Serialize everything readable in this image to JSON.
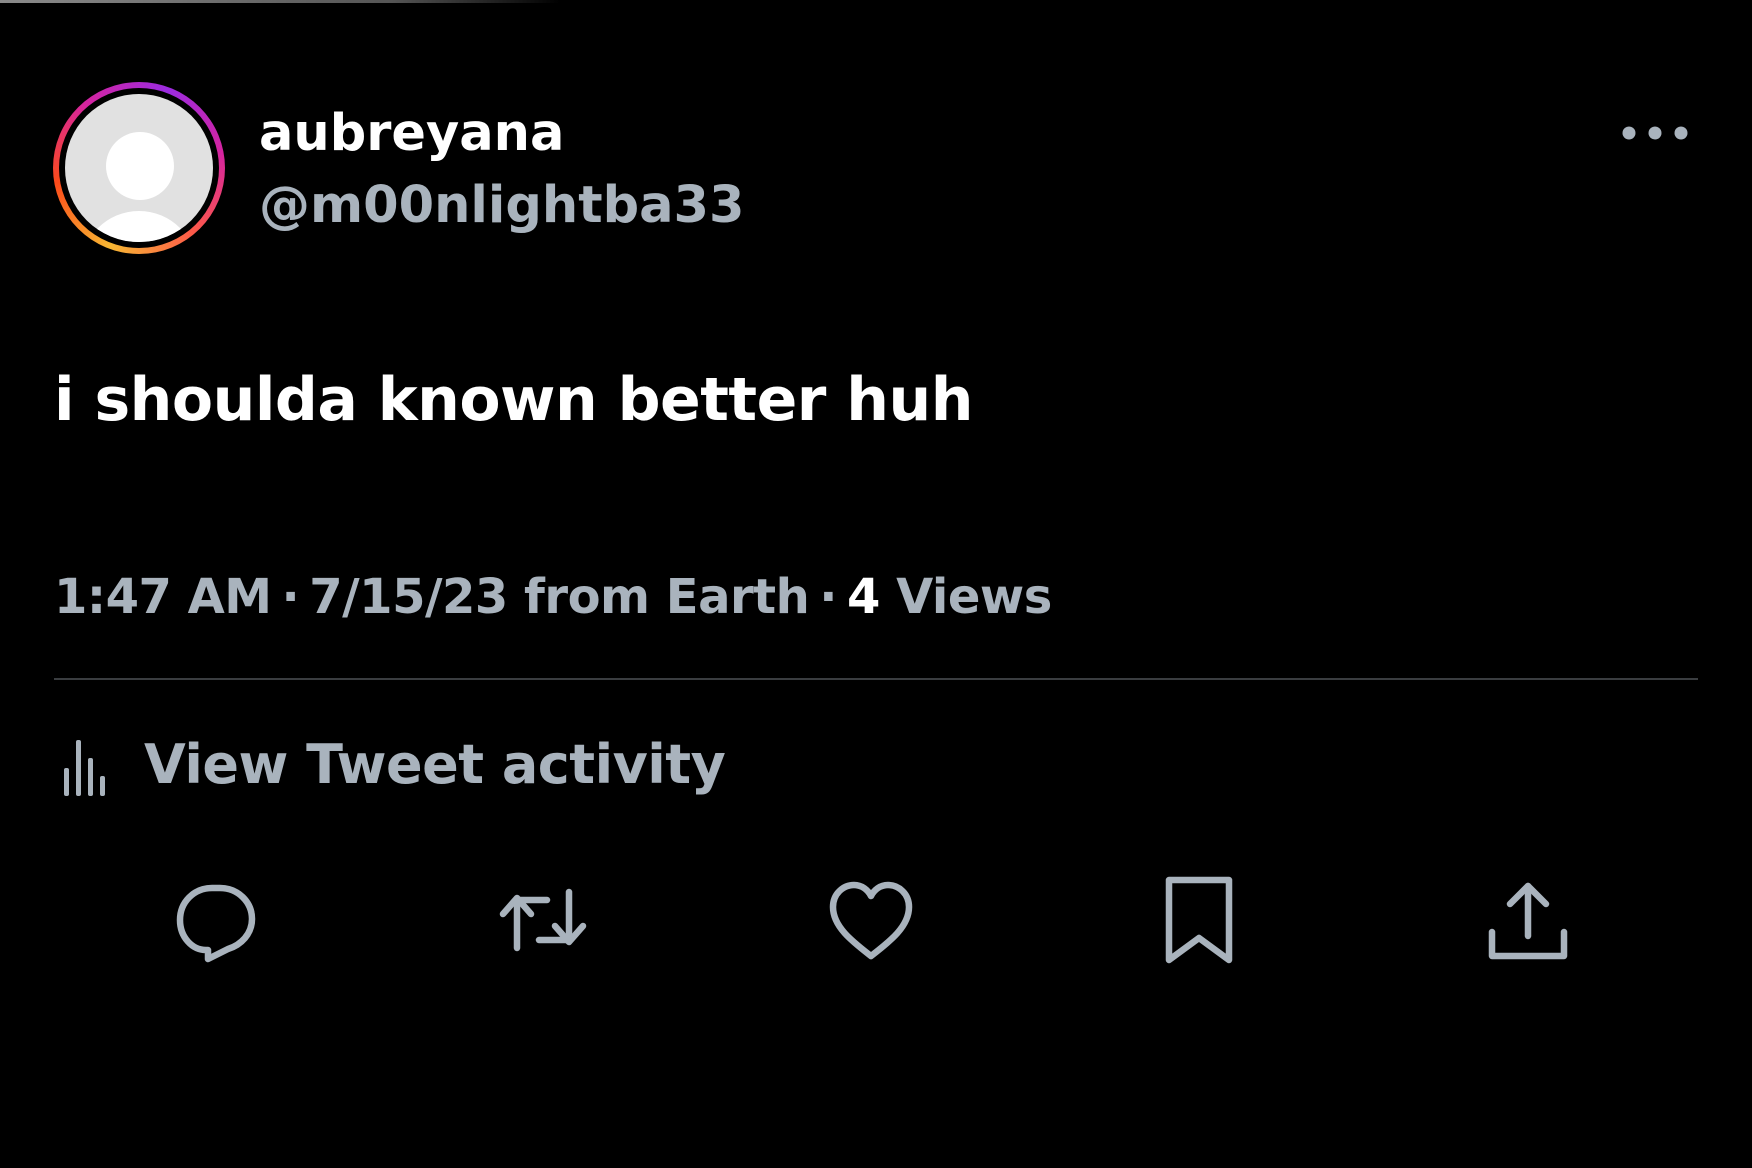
{
  "user": {
    "display_name": "aubreyana",
    "handle": "@m00nlightba33"
  },
  "tweet": {
    "text": "i shoulda known better huh",
    "time": "1:47 AM",
    "separator": "·",
    "date_source": "7/15/23 from Earth",
    "views_count": "4",
    "views_label": "Views"
  },
  "activity": {
    "label": "View Tweet activity"
  },
  "icons": {
    "more": "more-horizontal-icon",
    "activity": "bar-chart-icon",
    "reply": "reply-icon",
    "retweet": "retweet-icon",
    "like": "heart-icon",
    "bookmark": "bookmark-icon",
    "share": "share-icon"
  },
  "colors": {
    "background": "#000000",
    "primary_text": "#ffffff",
    "secondary_text": "#a9b3bd",
    "divider": "#3a3d40"
  }
}
